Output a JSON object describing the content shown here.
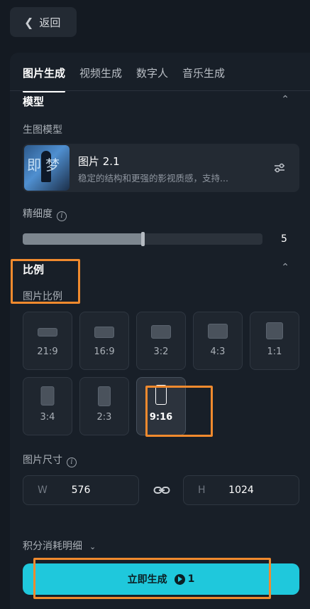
{
  "back": {
    "label": "返回"
  },
  "tabs": [
    {
      "label": "图片生成",
      "active": true
    },
    {
      "label": "视频生成",
      "active": false
    },
    {
      "label": "数字人",
      "active": false
    },
    {
      "label": "音乐生成",
      "active": false
    }
  ],
  "model_section": {
    "title": "模型",
    "field_label": "生图模型",
    "model": {
      "name": "图片 2.1",
      "description": "稳定的结构和更强的影视质感，支持..."
    },
    "thumb_text": "即梦"
  },
  "precision": {
    "label": "精细度",
    "value": "5",
    "fill_fraction": 0.5
  },
  "ratio_section": {
    "title": "比例",
    "field_label": "图片比例",
    "options": [
      {
        "label": "21:9",
        "selected": false
      },
      {
        "label": "16:9",
        "selected": false
      },
      {
        "label": "3:2",
        "selected": false
      },
      {
        "label": "4:3",
        "selected": false
      },
      {
        "label": "1:1",
        "selected": false
      },
      {
        "label": "3:4",
        "selected": false
      },
      {
        "label": "2:3",
        "selected": false
      },
      {
        "label": "9:16",
        "selected": true
      }
    ]
  },
  "size": {
    "label": "图片尺寸",
    "width_prefix": "W",
    "width": "576",
    "height_prefix": "H",
    "height": "1024"
  },
  "cost": {
    "label": "积分消耗明细"
  },
  "generate": {
    "label": "立即生成",
    "credits": "1"
  },
  "colors": {
    "accent": "#1fc8dc",
    "highlight": "#f08a2e"
  }
}
